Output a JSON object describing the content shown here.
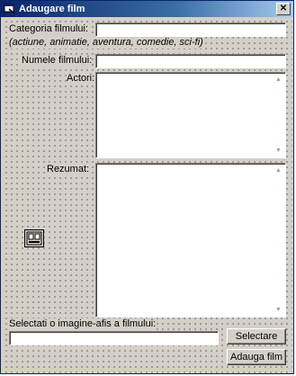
{
  "window": {
    "title": "Adaugare film",
    "close_glyph": "✕"
  },
  "form": {
    "category_label": "Categoria filmului:",
    "category_hint": "(actiune, animatie, aventura, comedie, sci-fi)",
    "category_value": "",
    "name_label": "Numele filmului:",
    "name_value": "",
    "actors_label": "Actori:",
    "actors_value": "",
    "summary_label": "Rezumat:",
    "summary_value": "",
    "poster_label": "Selectati o imagine-afis a filmului:",
    "poster_value": "",
    "select_button": "Selectare",
    "add_button": "Adauga film"
  },
  "icons": {
    "app": "app-window-icon",
    "close": "close-icon",
    "scroll_up": "scroll-up-arrow-icon",
    "scroll_down": "scroll-down-arrow-icon",
    "ole": "ole-container-icon"
  },
  "colors": {
    "titlebar_start": "#0a246a",
    "titlebar_end": "#a6caf0",
    "face": "#d4d0c8"
  }
}
